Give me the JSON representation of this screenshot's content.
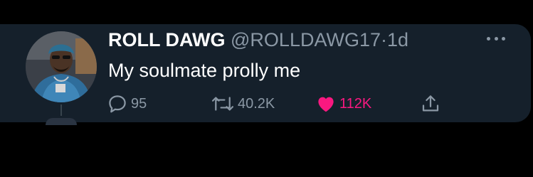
{
  "tweet": {
    "display_name": "ROLL DAWG",
    "handle": "@ROLLDAWG17",
    "separator": "·",
    "time": "1d",
    "text": "My soulmate prolly me",
    "reply_count": "95",
    "retweet_count": "40.2K",
    "like_count": "112K",
    "liked": true
  },
  "icons": {
    "reply": "speech-bubble-icon",
    "retweet": "retweet-arrows-icon",
    "like": "heart-icon",
    "share": "share-upload-icon",
    "more": "ellipsis-icon"
  },
  "colors": {
    "background": "#000000",
    "card": "#15202b",
    "text": "#ffffff",
    "muted": "#8b98a5",
    "like": "#f91880"
  }
}
